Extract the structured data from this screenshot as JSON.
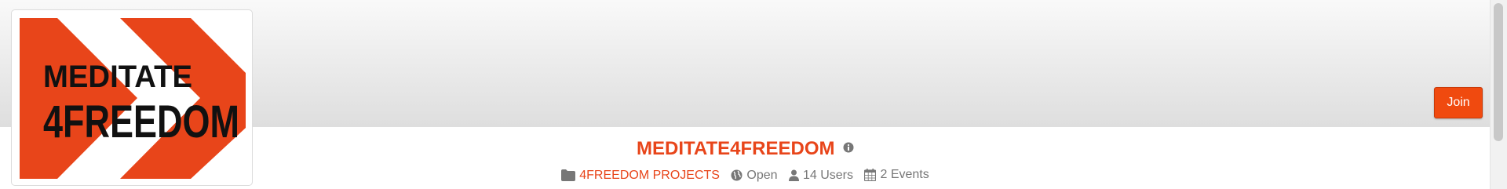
{
  "logo": {
    "line1": "MEDITATE",
    "line2": "4FREEDOM",
    "brand_color": "#e8451a"
  },
  "header": {
    "join_label": "Join"
  },
  "group": {
    "title": "MEDITATE4FREEDOM",
    "category": "4FREEDOM PROJECTS",
    "privacy": "Open",
    "users": "14 Users",
    "events": "2 Events"
  },
  "icons": [
    "info-icon",
    "folder-icon",
    "globe-icon",
    "user-icon",
    "calendar-icon"
  ]
}
